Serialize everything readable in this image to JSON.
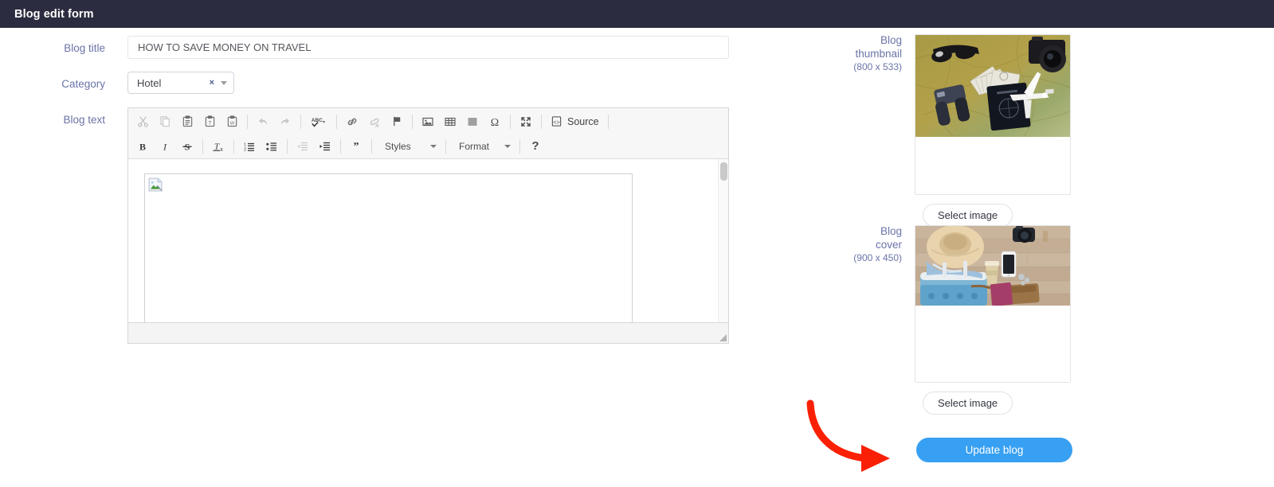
{
  "window": {
    "title": "Blog edit form"
  },
  "form": {
    "labels": {
      "blog_title": "Blog title",
      "category": "Category",
      "blog_text": "Blog text"
    },
    "blog_title": {
      "value": "HOW TO SAVE MONEY ON TRAVEL",
      "placeholder": ""
    },
    "category": {
      "value": "Hotel",
      "clear_symbol": "×"
    }
  },
  "editor": {
    "toolbar_row1": [
      {
        "name": "cut-icon",
        "label": "Cut",
        "disabled": true
      },
      {
        "name": "copy-icon",
        "label": "Copy",
        "disabled": true
      },
      {
        "name": "paste-icon",
        "label": "Paste",
        "disabled": false
      },
      {
        "name": "paste-text-icon",
        "label": "Paste as plain text",
        "disabled": false
      },
      {
        "name": "paste-word-icon",
        "label": "Paste from Word",
        "disabled": false
      },
      {
        "name": "undo-icon",
        "label": "Undo",
        "disabled": true
      },
      {
        "name": "redo-icon",
        "label": "Redo",
        "disabled": true
      },
      {
        "name": "spellcheck-icon",
        "label": "Spell Check As You Type",
        "disabled": false
      },
      {
        "name": "link-icon",
        "label": "Link",
        "disabled": false
      },
      {
        "name": "unlink-icon",
        "label": "Unlink",
        "disabled": true
      },
      {
        "name": "anchor-icon",
        "label": "Anchor",
        "disabled": false
      },
      {
        "name": "image-icon",
        "label": "Image",
        "disabled": false
      },
      {
        "name": "table-icon",
        "label": "Table",
        "disabled": false
      },
      {
        "name": "horizontal-rule-icon",
        "label": "Horizontal Line",
        "disabled": false
      },
      {
        "name": "special-char-icon",
        "label": "Insert Special Character",
        "disabled": false
      },
      {
        "name": "maximize-icon",
        "label": "Maximize",
        "disabled": false
      }
    ],
    "source_button": {
      "label": "Source",
      "icon": "source-icon"
    },
    "toolbar_row2": [
      {
        "name": "bold-icon",
        "label": "Bold",
        "disabled": false
      },
      {
        "name": "italic-icon",
        "label": "Italic",
        "disabled": false
      },
      {
        "name": "strikethrough-icon",
        "label": "Strikethrough",
        "disabled": false
      },
      {
        "name": "remove-format-icon",
        "label": "Remove Format",
        "disabled": false
      },
      {
        "name": "numbered-list-icon",
        "label": "Insert/Remove Numbered List",
        "disabled": false
      },
      {
        "name": "bulleted-list-icon",
        "label": "Insert/Remove Bulleted List",
        "disabled": false
      },
      {
        "name": "outdent-icon",
        "label": "Decrease Indent",
        "disabled": true
      },
      {
        "name": "indent-icon",
        "label": "Increase Indent",
        "disabled": false
      },
      {
        "name": "blockquote-icon",
        "label": "Block Quote",
        "disabled": false
      }
    ],
    "styles_combo": {
      "label": "Styles"
    },
    "format_combo": {
      "label": "Format"
    },
    "help_button": {
      "label": "?"
    },
    "content": {
      "broken_image": "broken-image-icon"
    }
  },
  "side": {
    "thumbnail": {
      "label_line1": "Blog",
      "label_line2": "thumbnail",
      "dimensions": "(800 x 533)",
      "select_button": "Select image",
      "image_alt": "travel-flatlay-map-money-passport-binoculars-camera-plane"
    },
    "cover": {
      "label_line1": "Blog",
      "label_line2": "cover",
      "dimensions": "(900 x 450)",
      "select_button": "Select image",
      "image_alt": "travel-flatlay-hat-suitcase-phone-coffee-wallet"
    },
    "update_button": {
      "label": "Update blog"
    },
    "annotation_arrow": {
      "name": "red-arrow-annotation",
      "color": "#fa2005"
    }
  },
  "colors": {
    "header_bg": "#2b2c3f",
    "label_text": "#6b74a8",
    "primary_button": "#38a0f2",
    "annotation": "#fa2005"
  }
}
